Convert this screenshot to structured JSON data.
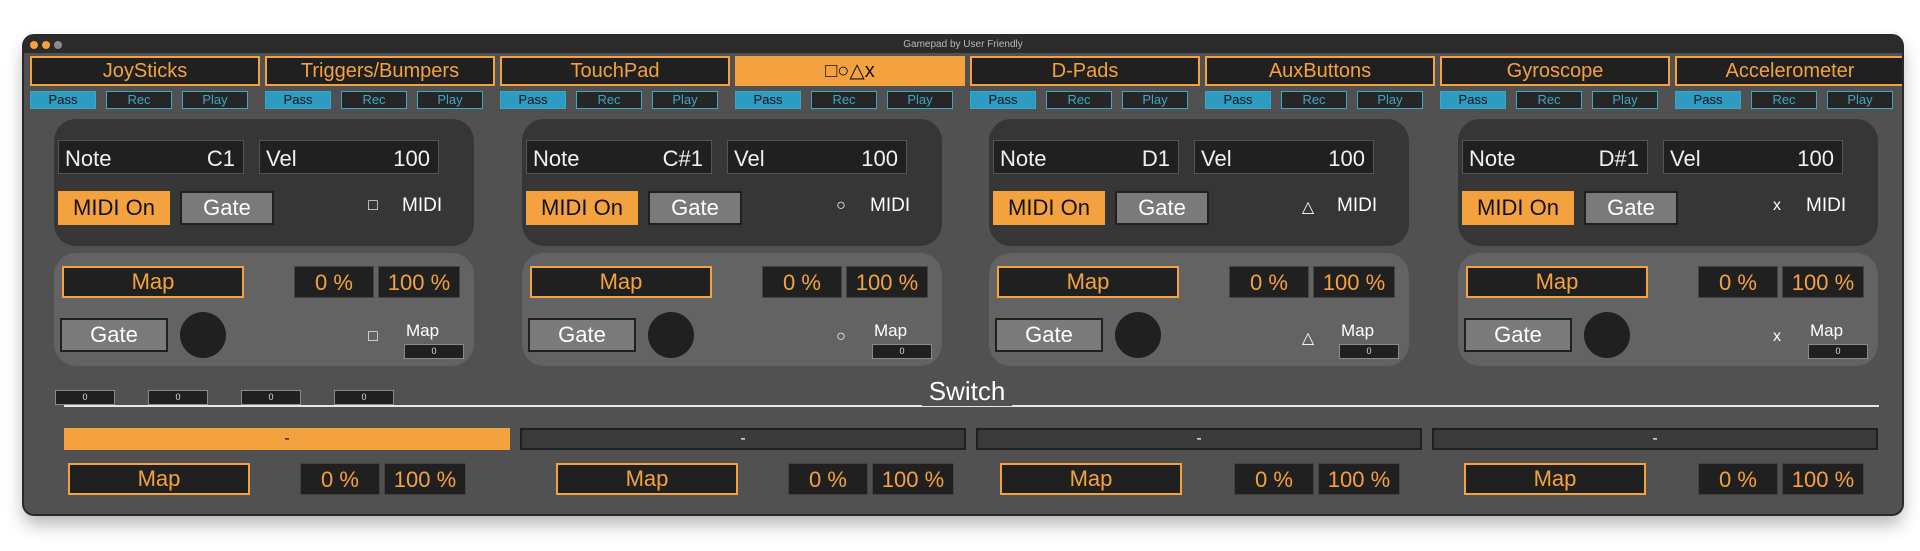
{
  "window": {
    "title": "Gamepad by User Friendly"
  },
  "tabs": [
    "JoySticks",
    "Triggers/Bumpers",
    "TouchPad",
    "□○△x",
    "D-Pads",
    "AuxButtons",
    "Gyroscope",
    "Accelerometer"
  ],
  "transport": {
    "pass": "Pass",
    "rec": "Rec",
    "play": "Play"
  },
  "top_sections": [
    {
      "note_label": "Note",
      "note": "C1",
      "vel_label": "Vel",
      "vel": "100",
      "midi_on": "MIDI On",
      "gate": "Gate",
      "symbol": "□",
      "midi": "MIDI",
      "map": "Map",
      "pct_min": "0 %",
      "pct_max": "100 %",
      "gate2": "Gate",
      "map_label": "Map",
      "map_value": "0"
    },
    {
      "note_label": "Note",
      "note": "C#1",
      "vel_label": "Vel",
      "vel": "100",
      "midi_on": "MIDI On",
      "gate": "Gate",
      "symbol": "○",
      "midi": "MIDI",
      "map": "Map",
      "pct_min": "0 %",
      "pct_max": "100 %",
      "gate2": "Gate",
      "map_label": "Map",
      "map_value": "0"
    },
    {
      "note_label": "Note",
      "note": "D1",
      "vel_label": "Vel",
      "vel": "100",
      "midi_on": "MIDI On",
      "gate": "Gate",
      "symbol": "△",
      "midi": "MIDI",
      "map": "Map",
      "pct_min": "0 %",
      "pct_max": "100 %",
      "gate2": "Gate",
      "map_label": "Map",
      "map_value": "0"
    },
    {
      "note_label": "Note",
      "note": "D#1",
      "vel_label": "Vel",
      "vel": "100",
      "midi_on": "MIDI On",
      "gate": "Gate",
      "symbol": "x",
      "midi": "MIDI",
      "map": "Map",
      "pct_min": "0 %",
      "pct_max": "100 %",
      "gate2": "Gate",
      "map_label": "Map",
      "map_value": "0"
    }
  ],
  "small_values": [
    "0",
    "0",
    "0",
    "0"
  ],
  "switch": {
    "label": "Switch"
  },
  "bottom": [
    {
      "sel": "-",
      "map": "Map",
      "pct_min": "0 %",
      "pct_max": "100 %"
    },
    {
      "sel": "-",
      "map": "Map",
      "pct_min": "0 %",
      "pct_max": "100 %"
    },
    {
      "sel": "-",
      "map": "Map",
      "pct_min": "0 %",
      "pct_max": "100 %"
    },
    {
      "sel": "-",
      "map": "Map",
      "pct_min": "0 %",
      "pct_max": "100 %"
    }
  ],
  "colors": {
    "accent": "#f4a240",
    "link": "#3aa7c9"
  }
}
